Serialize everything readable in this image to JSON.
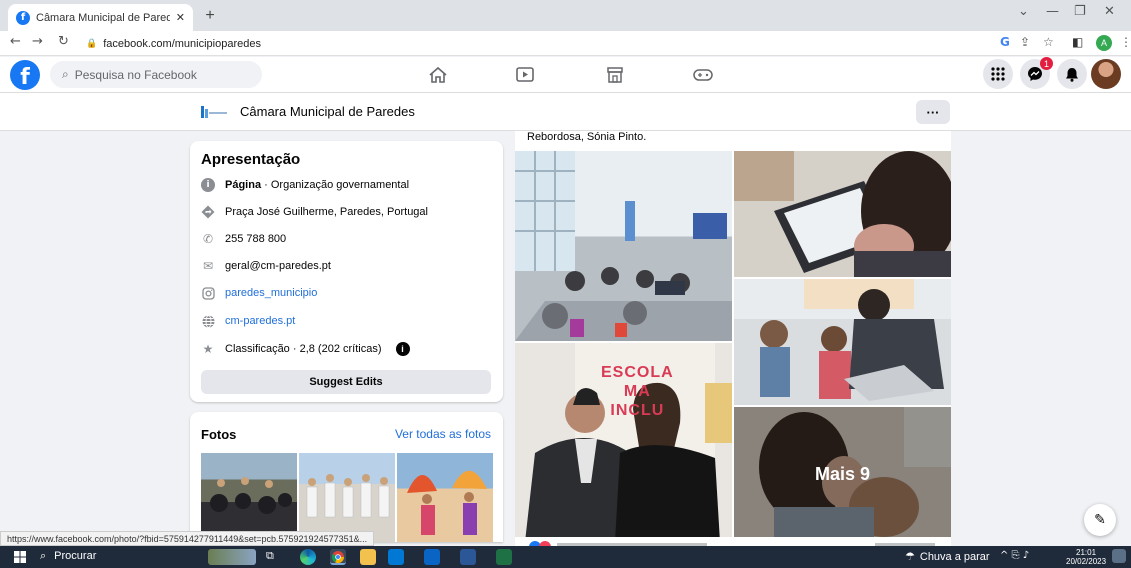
{
  "browser": {
    "tab_title": "Câmara Municipal de Paredes | F",
    "url": "facebook.com/municipioparedes",
    "profile_initial": "A",
    "status_url": "https://www.facebook.com/photo/?fbid=575914277911449&set=pcb.575921924577351&..."
  },
  "facebook": {
    "search_placeholder": "Pesquisa no Facebook",
    "notification_count": "1",
    "page_name": "Câmara Municipal de Paredes",
    "more_label": "···"
  },
  "intro": {
    "title": "Apresentação",
    "category_bold": "Página",
    "category_rest": " · Organização governamental",
    "address": "Praça José Guilherme, Paredes, Portugal",
    "phone": "255 788 800",
    "email": "geral@cm-paredes.pt",
    "instagram": "paredes_municipio",
    "website": "cm-paredes.pt",
    "rating": "Classificação · 2,8 (202 críticas)",
    "suggest_edits": "Suggest Edits"
  },
  "fotos": {
    "title": "Fotos",
    "see_all": "Ver todas as fotos"
  },
  "post": {
    "text_tail": "Rebordosa, Sónia Pinto.",
    "banner_text": "ESCOLA\nMA\nINCLU",
    "more_photos": "Mais 9"
  },
  "taskbar": {
    "search_label": "Procurar",
    "weather": "Chuva a parar",
    "time": "21:01",
    "date": "20/02/2023"
  },
  "colors": {
    "facebook_blue": "#1877f2",
    "link": "#216fdb",
    "notification_red": "#e41e3f"
  }
}
